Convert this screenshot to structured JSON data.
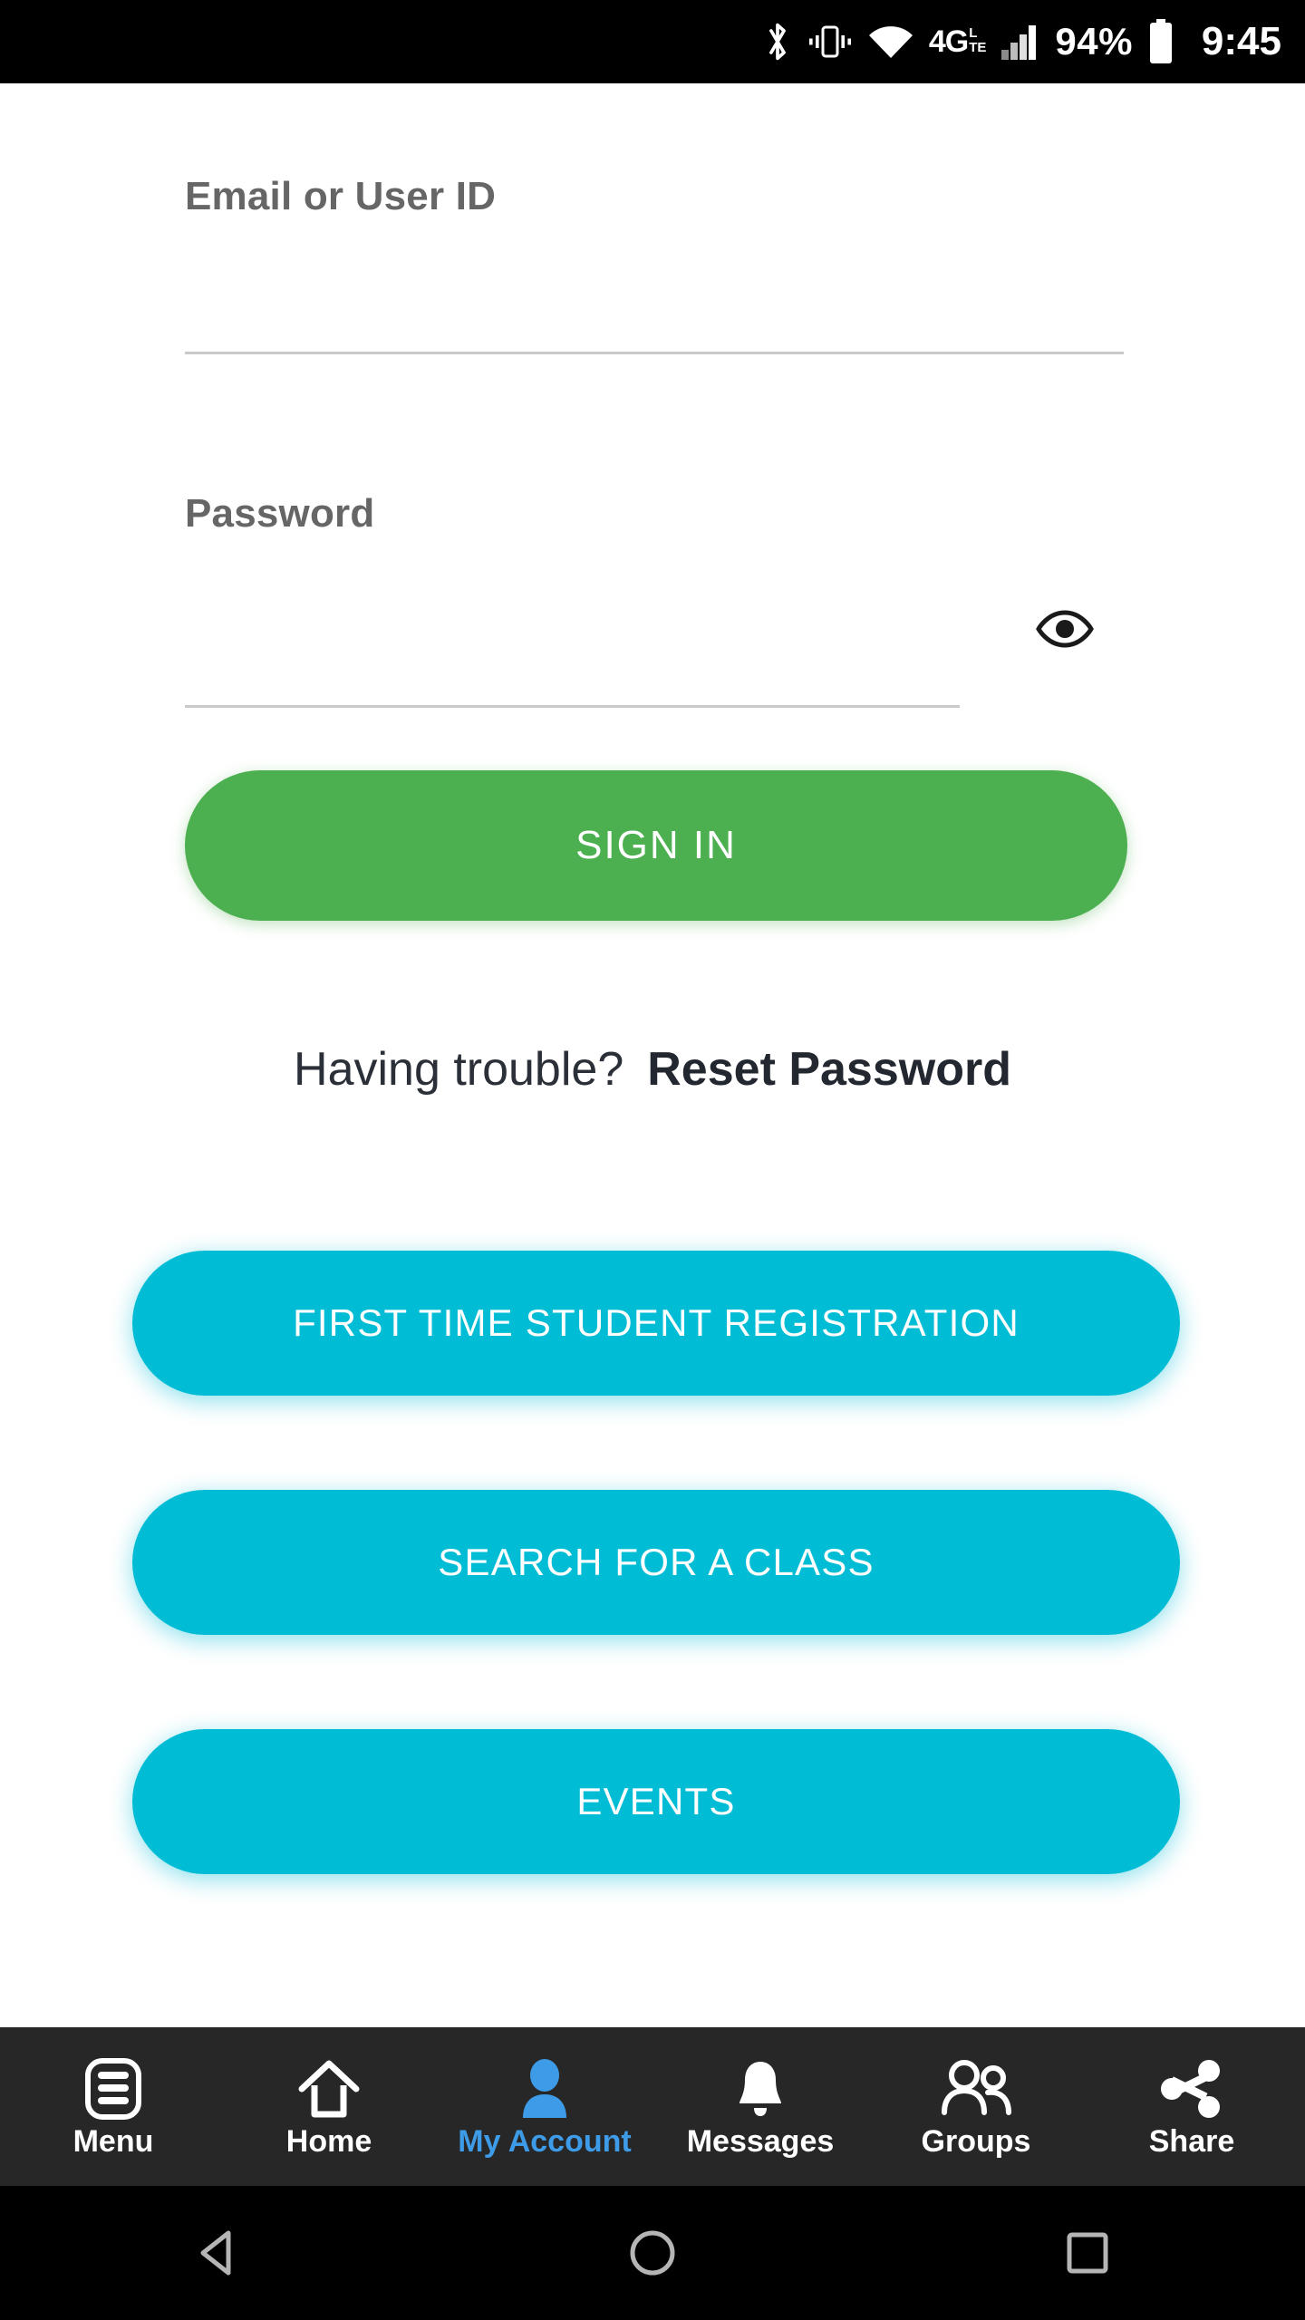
{
  "status_bar": {
    "bluetooth_icon": "bluetooth-icon",
    "vibrate_icon": "vibrate-icon",
    "wifi_icon": "wifi-icon",
    "network_type": "4G",
    "network_type_sup_top": "L",
    "network_type_sup_bottom": "TE",
    "signal_icon": "cellular-signal-icon",
    "battery_percent": "94%",
    "battery_icon": "battery-icon",
    "time": "9:45"
  },
  "form": {
    "email": {
      "label": "Email or User ID",
      "value": "",
      "placeholder": ""
    },
    "password": {
      "label": "Password",
      "value": "",
      "placeholder": "",
      "toggle_icon": "eye-icon"
    },
    "sign_in_label": "SIGN IN",
    "trouble_text": "Having trouble?",
    "reset_password_label": "Reset Password"
  },
  "actions": [
    {
      "label": "FIRST TIME STUDENT REGISTRATION",
      "name": "first-time-student-registration-button"
    },
    {
      "label": "SEARCH FOR A CLASS",
      "name": "search-for-a-class-button"
    },
    {
      "label": "EVENTS",
      "name": "events-button"
    }
  ],
  "bottom_nav": {
    "items": [
      {
        "label": "Menu",
        "icon": "menu-list-icon",
        "active": false
      },
      {
        "label": "Home",
        "icon": "home-icon",
        "active": false
      },
      {
        "label": "My Account",
        "icon": "person-icon",
        "active": true
      },
      {
        "label": "Messages",
        "icon": "bell-icon",
        "active": false
      },
      {
        "label": "Groups",
        "icon": "people-group-icon",
        "active": false
      },
      {
        "label": "Share",
        "icon": "share-icon",
        "active": false
      }
    ]
  },
  "system_bar": {
    "back_icon": "triangle-back-icon",
    "home_icon": "circle-home-icon",
    "recents_icon": "square-recents-icon"
  },
  "colors": {
    "primary_green": "#4CAF50",
    "primary_cyan": "#00BCD4",
    "accent_blue": "#3E9BE8",
    "nav_background": "#272727",
    "status_background": "#000000",
    "label_gray": "#666666",
    "underline_gray": "#c9c9c9"
  }
}
